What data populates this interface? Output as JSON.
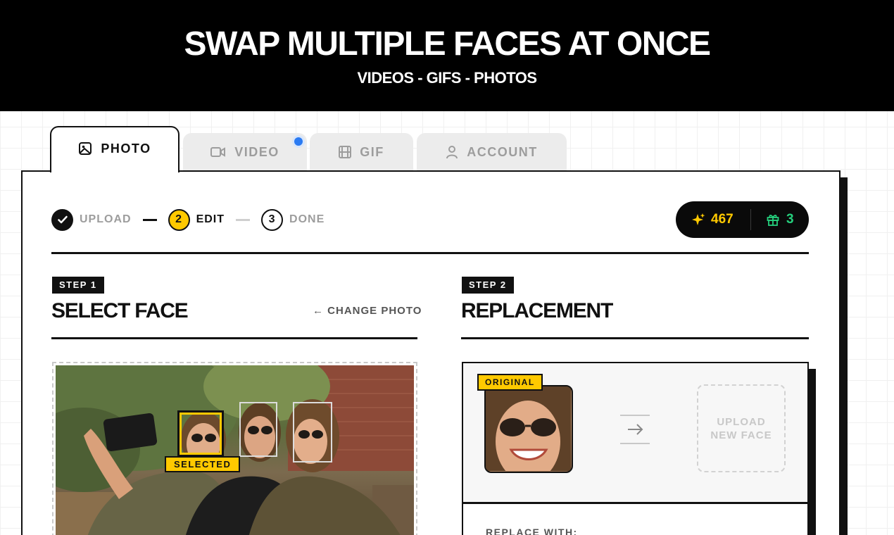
{
  "hero": {
    "title": "SWAP MULTIPLE FACES AT ONCE",
    "subtitle": "VIDEOS - GIFS - PHOTOS"
  },
  "tabs": [
    {
      "label": "PHOTO",
      "icon": "image-icon",
      "active": true
    },
    {
      "label": "VIDEO",
      "icon": "video-camera-icon",
      "active": false,
      "notification": true
    },
    {
      "label": "GIF",
      "icon": "film-icon",
      "active": false
    },
    {
      "label": "ACCOUNT",
      "icon": "user-icon",
      "active": false
    }
  ],
  "stepper": {
    "steps": [
      {
        "number": "✓",
        "label": "UPLOAD",
        "state": "done"
      },
      {
        "number": "2",
        "label": "EDIT",
        "state": "active"
      },
      {
        "number": "3",
        "label": "DONE",
        "state": "pending"
      }
    ]
  },
  "credits": {
    "spark_count": "467",
    "gift_count": "3"
  },
  "step1": {
    "badge": "STEP 1",
    "title": "SELECT FACE",
    "change_photo": "← CHANGE PHOTO",
    "selected_tag": "SELECTED"
  },
  "step2": {
    "badge": "STEP 2",
    "title": "REPLACEMENT",
    "original_tag": "ORIGINAL",
    "upload_line1": "UPLOAD",
    "upload_line2": "NEW FACE",
    "replace_with": "REPLACE WITH:"
  },
  "colors": {
    "accent_yellow": "#ffc900",
    "gift_green": "#25d07d",
    "notify_blue": "#2b7bf2",
    "ink": "#111111"
  }
}
